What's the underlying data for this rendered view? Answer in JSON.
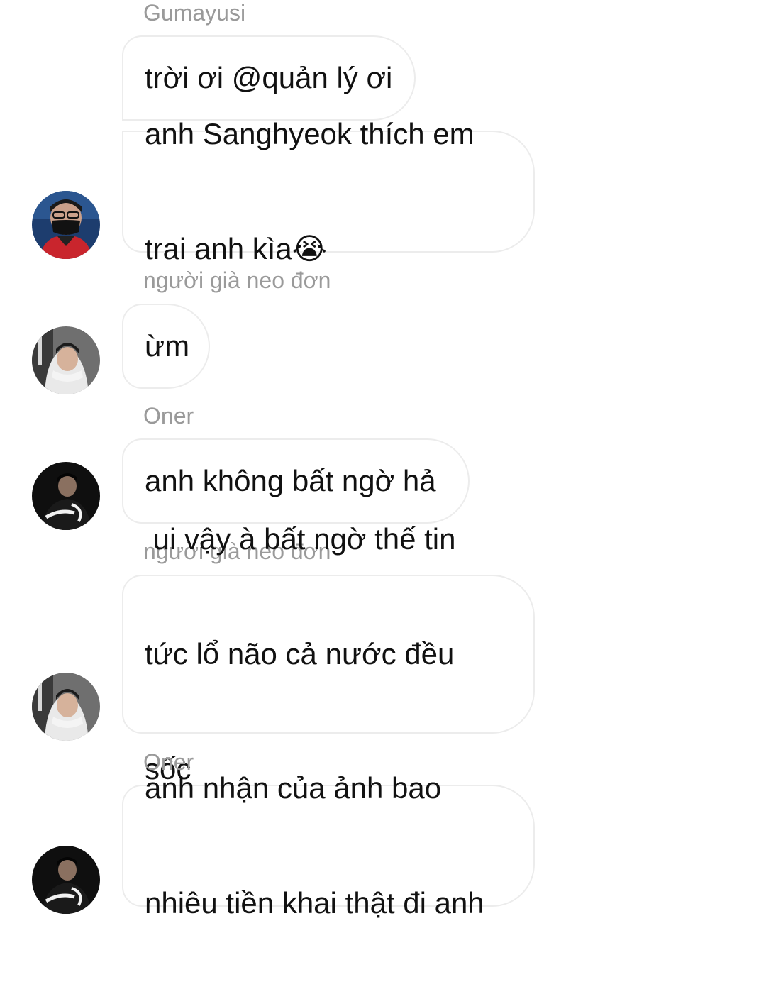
{
  "conversation": {
    "messages": [
      {
        "sender": "Gumayusi",
        "lines": [
          "trời ơi @quản lý ơi"
        ]
      },
      {
        "lines": [
          "anh Sanghyeok thích em",
          "trai anh kìa😭"
        ]
      },
      {
        "sender": "người già neo đơn",
        "lines": [
          "ừm"
        ]
      },
      {
        "sender": "Oner",
        "lines": [
          "anh không bất ngờ hả"
        ]
      },
      {
        "sender": "người già neo đơn",
        "lines": [
          " ui vậy à bất ngờ thế tin",
          "tức lổ não cả nước đều",
          "sốc"
        ]
      },
      {
        "sender": "Oner",
        "lines": [
          "anh nhận của ảnh bao",
          "nhiêu tiền khai thật đi anh"
        ]
      }
    ]
  },
  "colors": {
    "sender_name": "#9a9a9a",
    "message_text": "#111111",
    "bubble_border": "#ececec",
    "background": "#ffffff"
  },
  "icons": {
    "avatars": [
      "avatar-gumayusi",
      "avatar-nguoi-gia-neo-don",
      "avatar-oner"
    ]
  }
}
